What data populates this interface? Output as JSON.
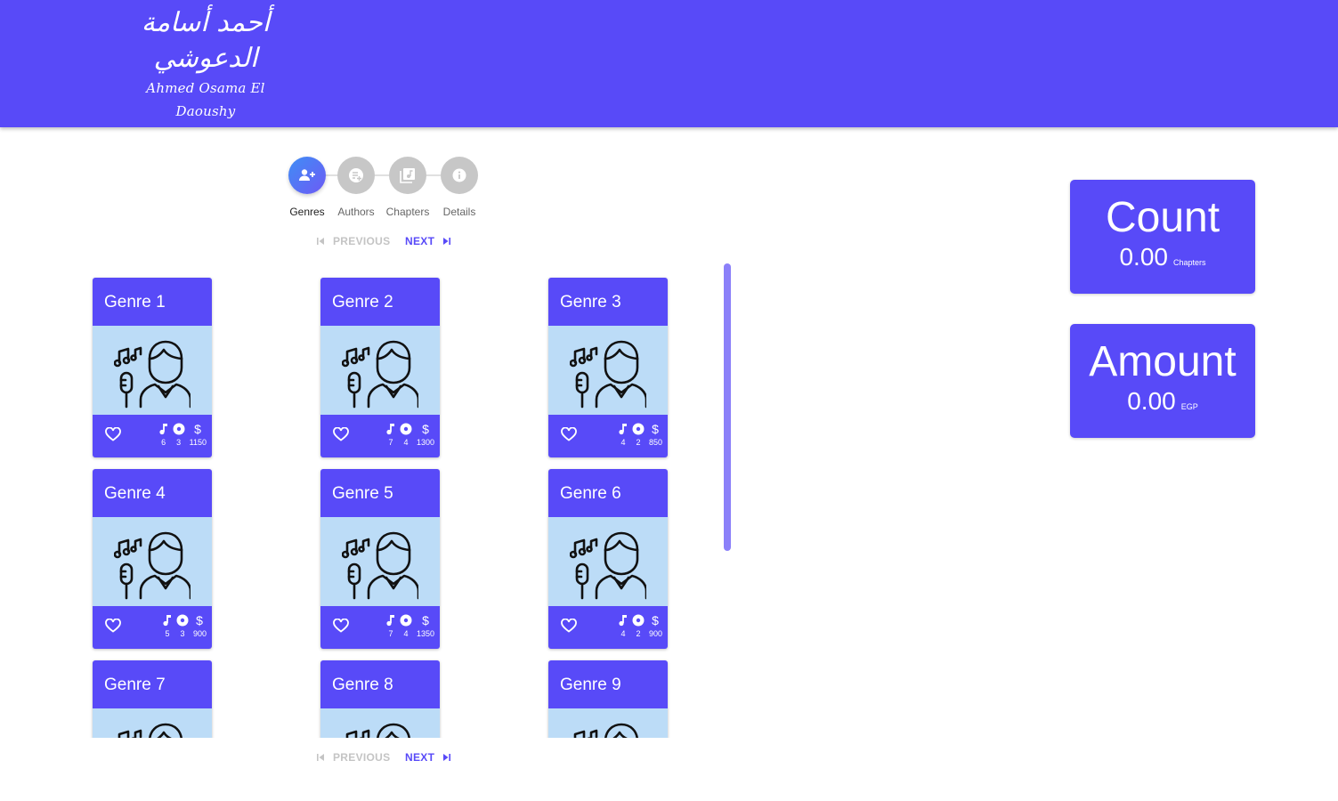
{
  "logo": {
    "arabic_line1": "أحمد أسامة",
    "arabic_line2": "الدعوشي",
    "english": "Ahmed Osama El Daoushy"
  },
  "stepper": {
    "steps": [
      {
        "label": "Genres",
        "icon": "person-add-icon",
        "active": true
      },
      {
        "label": "Authors",
        "icon": "playlist-add-icon",
        "active": false
      },
      {
        "label": "Chapters",
        "icon": "library-music-icon",
        "active": false
      },
      {
        "label": "Details",
        "icon": "info-icon",
        "active": false
      }
    ]
  },
  "pager": {
    "previous": "PREVIOUS",
    "next": "NEXT"
  },
  "genres": [
    {
      "title": "Genre 1",
      "songs": "6",
      "albums": "3",
      "price": "1150"
    },
    {
      "title": "Genre 2",
      "songs": "7",
      "albums": "4",
      "price": "1300"
    },
    {
      "title": "Genre 3",
      "songs": "4",
      "albums": "2",
      "price": "850"
    },
    {
      "title": "Genre 4",
      "songs": "5",
      "albums": "3",
      "price": "900"
    },
    {
      "title": "Genre 5",
      "songs": "7",
      "albums": "4",
      "price": "1350"
    },
    {
      "title": "Genre 6",
      "songs": "4",
      "albums": "2",
      "price": "900"
    },
    {
      "title": "Genre 7"
    },
    {
      "title": "Genre 8"
    },
    {
      "title": "Genre 9"
    }
  ],
  "summary": {
    "count": {
      "title": "Count",
      "value": "0.00",
      "unit": "Chapters"
    },
    "amount": {
      "title": "Amount",
      "value": "0.00",
      "unit": "EGP"
    }
  },
  "colors": {
    "primary": "#584af8",
    "card_image_bg": "#bcdcf7",
    "disabled": "#c4c4c4"
  }
}
